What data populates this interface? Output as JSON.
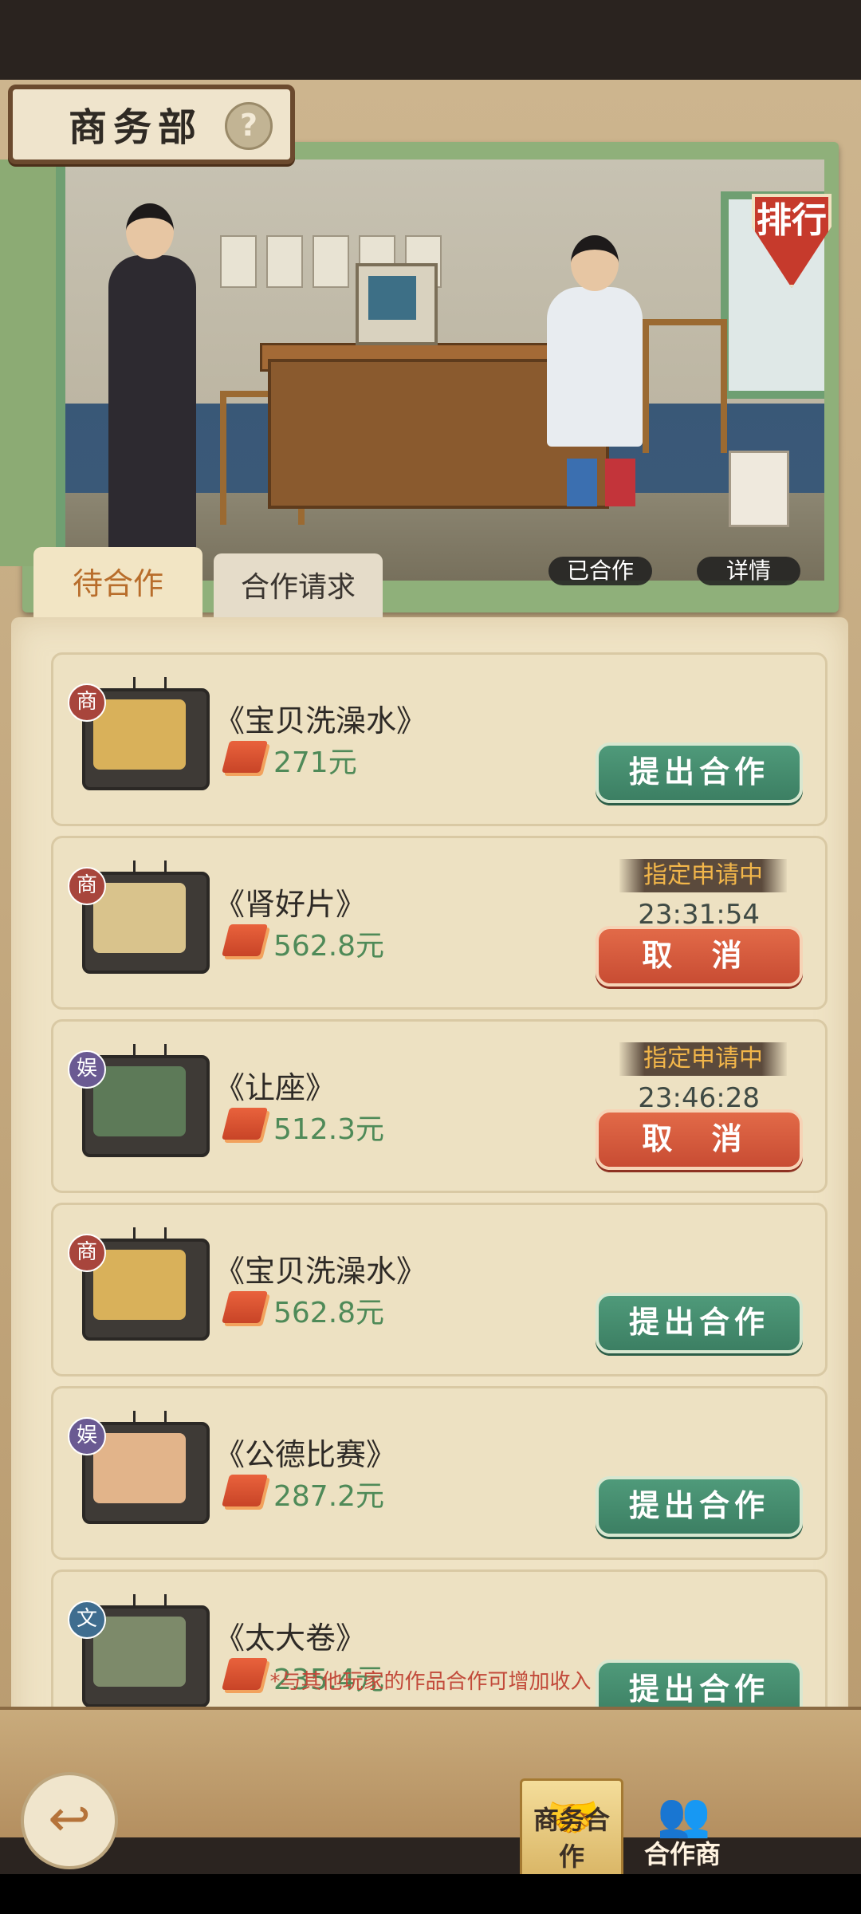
{
  "header": {
    "title": "商务部",
    "help_icon": "?",
    "rank_label": "排行",
    "cooperated_label": "已合作",
    "details_label": "详情"
  },
  "tabs": [
    {
      "label": "待合作",
      "active": true
    },
    {
      "label": "合作请求",
      "active": false
    }
  ],
  "cards": [
    {
      "category": "商",
      "category_color": "#a8453c",
      "name": "《宝贝洗澡水》",
      "price": "271元",
      "action": "提出合作",
      "state": "idle",
      "screen_color": "#d9b15a"
    },
    {
      "category": "商",
      "category_color": "#a8453c",
      "name": "《肾好片》",
      "price": "562.8元",
      "action": "取 消",
      "state": "pending",
      "status": "指定申请中",
      "timer": "23:31:54",
      "screen_color": "#d9c38c"
    },
    {
      "category": "娱",
      "category_color": "#6a5a92",
      "name": "《让座》",
      "price": "512.3元",
      "action": "取 消",
      "state": "pending",
      "status": "指定申请中",
      "timer": "23:46:28",
      "screen_color": "#5d7a58"
    },
    {
      "category": "商",
      "category_color": "#a8453c",
      "name": "《宝贝洗澡水》",
      "price": "562.8元",
      "action": "提出合作",
      "state": "idle",
      "screen_color": "#d9b15a"
    },
    {
      "category": "娱",
      "category_color": "#6a5a92",
      "name": "《公德比赛》",
      "price": "287.2元",
      "action": "提出合作",
      "state": "idle",
      "screen_color": "#e2b48a"
    },
    {
      "category": "文",
      "category_color": "#3f6d8f",
      "name": "《太大卷》",
      "price": "235.4元",
      "action": "提出合作",
      "state": "idle",
      "screen_color": "#7d8a6a"
    }
  ],
  "hint": "*与其他玩家的作品合作可增加收入",
  "nav": {
    "back_icon": "↩",
    "business_label": "商务合作",
    "partner_label": "合作商"
  }
}
